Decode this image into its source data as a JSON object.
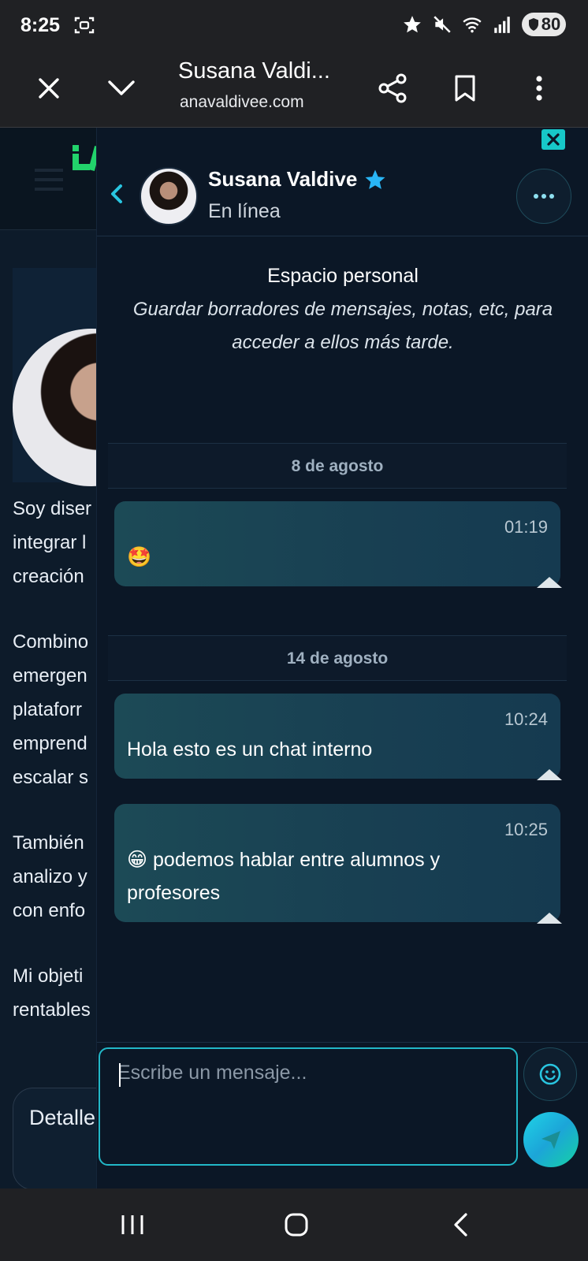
{
  "status_bar": {
    "time": "8:25",
    "battery": "80"
  },
  "browser": {
    "title": "Susana Valdi...",
    "url": "anavaldivee.com"
  },
  "background_page": {
    "lines": [
      "Soy diser",
      "integrar l",
      "creación",
      "Combino",
      "emergen",
      "plataforr",
      "emprend",
      "escalar s",
      "También",
      "analizo y",
      "con enfo",
      "Mi objeti",
      "rentables"
    ],
    "detail_label": "Detalle"
  },
  "chat": {
    "contact_name": "Susana Valdive",
    "contact_status": "En línea",
    "personal_title": "Espacio personal",
    "personal_subtitle": "Guardar borradores de mensajes, notas, etc, para acceder a ellos más tarde.",
    "dates": [
      "8 de agosto",
      "14 de agosto"
    ],
    "messages": [
      {
        "time": "01:19",
        "text": "🤩"
      },
      {
        "time": "10:24",
        "text": "Hola esto es un chat interno"
      },
      {
        "time": "10:25",
        "text": "😁 podemos hablar entre alumnos y profesores"
      }
    ],
    "input_placeholder": "Escribe un mensaje..."
  },
  "colors": {
    "accent": "#22b8c8",
    "bubble": "#1c4a56",
    "verified": "#29b6f6"
  }
}
